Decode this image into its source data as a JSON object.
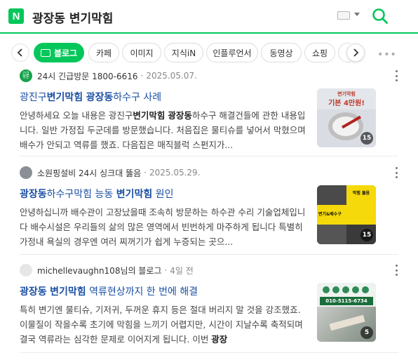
{
  "header": {
    "logo_letter": "N",
    "query": "광장동 변기막힘"
  },
  "tabs": [
    {
      "label": "블로그",
      "active": true
    },
    {
      "label": "카페"
    },
    {
      "label": "이미지"
    },
    {
      "label": "지식iN"
    },
    {
      "label": "인플루언서"
    },
    {
      "label": "동영상"
    },
    {
      "label": "쇼핑"
    }
  ],
  "results": [
    {
      "author": "24시 긴급방문 1800-6616",
      "date": "2025.05.07.",
      "avatar_text": "긴급\n방문",
      "title_parts": [
        "광진구",
        "변기막힘",
        " ",
        "광장동",
        "하수구 사례"
      ],
      "body_parts": [
        "안녕하세요 오늘 내용은 광진구",
        "변기막힘",
        " ",
        "광장동",
        "하수구 해결건들에 관한 내용입니다. 일반 가정집 두군데를 방문했습니다. 처음집은 물티슈를 넣어서 막혔으며 배수가 안되고 역류를 했죠. 다음집은 매직블럭 스펀지가..."
      ],
      "thumb_count": "15",
      "thumb_caption": "변기막힘",
      "thumb_caption2": "기본 4만원!"
    },
    {
      "author": "소원핑설비 24시 싱크대 뚫음",
      "date": "2025.05.29.",
      "title_parts": [
        "광장동",
        "하수구막힘 능동 ",
        "변기막힘",
        " 원인"
      ],
      "body_parts": [
        "안녕하십니까 배수관이 고장났을때 조속히 방문하는 하수관 수리 기술업체입니다 배수시설은 우리들의 삶의 많은 영역에서 빈번하게 마주하게 됩니다 특별히 가정내 욕실의 경우엔 여러 찌꺼기가 쉽게 누증되는 곳으..."
      ],
      "thumb_count": "15",
      "thumb_caption": "막힘 뚫음",
      "thumb_caption2": "변기&배수구"
    },
    {
      "author": "michellevaughn108님의 블로그",
      "date": "4일 전",
      "title_parts": [
        "광장동",
        " ",
        "변기막힘",
        " 역류현상까지 한 번에 해결"
      ],
      "body_parts": [
        "특히 변기엔 물티슈, 기저귀, 두꺼운 휴지 등은 절대 버리지 말 것을 강조했죠. 이물질이 작을수록 초기에 막힘을 느끼기 어렵지만, 시간이 지날수록 축적되며 결국 역류라는 심각한 문제로 이어지게 됩니다. 이번 ",
        "광장"
      ],
      "thumb_count": "5",
      "thumb_caption": "010-5115-6734"
    }
  ],
  "colors": {
    "brand": "#03c75a",
    "link": "#1a4fa3"
  }
}
